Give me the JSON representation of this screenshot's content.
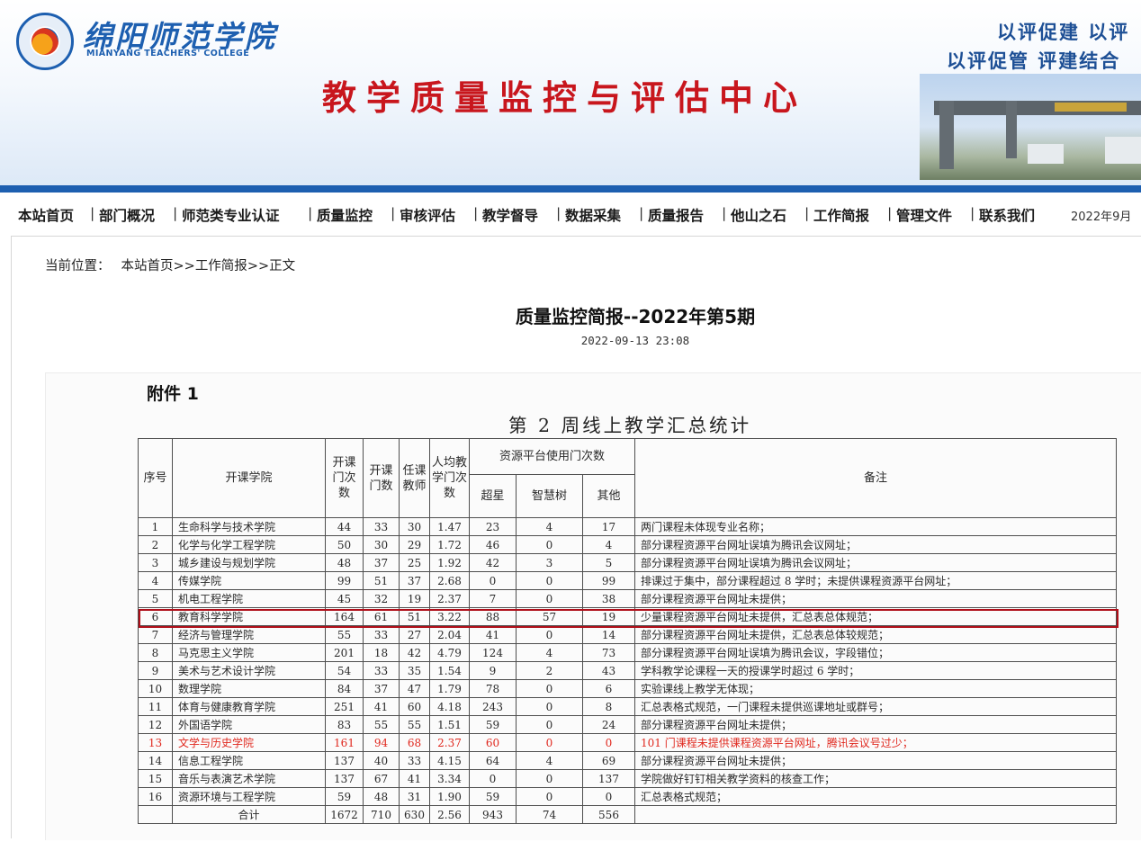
{
  "header": {
    "logo_text": "绵阳师范学院",
    "logo_en": "MIANYANG TEACHERS' COLLEGE",
    "center_title": "教学质量监控与评估中心",
    "slogan_line1": "以评促建 以评",
    "slogan_line2": "以评促管 评建结合"
  },
  "nav": {
    "items": [
      "本站首页",
      "部门概况",
      "师范类专业认证",
      "质量监控",
      "审核评估",
      "教学督导",
      "数据采集",
      "质量报告",
      "他山之石",
      "工作简报",
      "管理文件",
      "联系我们"
    ],
    "separator": "|",
    "date_text": "2022年9月"
  },
  "breadcrumb": {
    "label": "当前位置：",
    "home": "本站首页",
    "sep": ">>",
    "section": "工作简报",
    "current": "正文"
  },
  "article": {
    "title": "质量监控简报--2022年第5期",
    "time": "2022-09-13 23:08"
  },
  "attachment": {
    "label": "附件 1",
    "table_title": "第 2 周线上教学汇总统计",
    "headers": {
      "seq": "序号",
      "college": "开课学院",
      "course_sessions": "开课门次数",
      "courses": "开课门数",
      "teachers": "任课教师",
      "avg_per_teacher": "人均教学门次数",
      "platform_group": "资源平台使用门次数",
      "chaoxing": "超星",
      "zhihuishu": "智慧树",
      "other": "其他",
      "remark": "备注"
    },
    "rows": [
      {
        "seq": "1",
        "college": "生命科学与技术学院",
        "sessions": "44",
        "courses": "33",
        "teachers": "30",
        "avg": "1.47",
        "chaoxing": "23",
        "zhihuishu": "4",
        "other": "17",
        "remark": "两门课程未体现专业名称；"
      },
      {
        "seq": "2",
        "college": "化学与化学工程学院",
        "sessions": "50",
        "courses": "30",
        "teachers": "29",
        "avg": "1.72",
        "chaoxing": "46",
        "zhihuishu": "0",
        "other": "4",
        "remark": "部分课程资源平台网址误填为腾讯会议网址；"
      },
      {
        "seq": "3",
        "college": "城乡建设与规划学院",
        "sessions": "48",
        "courses": "37",
        "teachers": "25",
        "avg": "1.92",
        "chaoxing": "42",
        "zhihuishu": "3",
        "other": "5",
        "remark": "部分课程资源平台网址误填为腾讯会议网址；"
      },
      {
        "seq": "4",
        "college": "传媒学院",
        "sessions": "99",
        "courses": "51",
        "teachers": "37",
        "avg": "2.68",
        "chaoxing": "0",
        "zhihuishu": "0",
        "other": "99",
        "remark": "排课过于集中，部分课程超过 8 学时；未提供课程资源平台网址；"
      },
      {
        "seq": "5",
        "college": "机电工程学院",
        "sessions": "45",
        "courses": "32",
        "teachers": "19",
        "avg": "2.37",
        "chaoxing": "7",
        "zhihuishu": "0",
        "other": "38",
        "remark": "部分课程资源平台网址未提供；"
      },
      {
        "seq": "6",
        "college": "教育科学学院",
        "sessions": "164",
        "courses": "61",
        "teachers": "51",
        "avg": "3.22",
        "chaoxing": "88",
        "zhihuishu": "57",
        "other": "19",
        "remark": "少量课程资源平台网址未提供，汇总表总体规范；"
      },
      {
        "seq": "7",
        "college": "经济与管理学院",
        "sessions": "55",
        "courses": "33",
        "teachers": "27",
        "avg": "2.04",
        "chaoxing": "41",
        "zhihuishu": "0",
        "other": "14",
        "remark": "部分课程资源平台网址未提供，汇总表总体较规范；"
      },
      {
        "seq": "8",
        "college": "马克思主义学院",
        "sessions": "201",
        "courses": "18",
        "teachers": "42",
        "avg": "4.79",
        "chaoxing": "124",
        "zhihuishu": "4",
        "other": "73",
        "remark": "部分课程资源平台网址误填为腾讯会议，字段错位；"
      },
      {
        "seq": "9",
        "college": "美术与艺术设计学院",
        "sessions": "54",
        "courses": "33",
        "teachers": "35",
        "avg": "1.54",
        "chaoxing": "9",
        "zhihuishu": "2",
        "other": "43",
        "remark": "学科教学论课程一天的授课学时超过 6 学时；"
      },
      {
        "seq": "10",
        "college": "数理学院",
        "sessions": "84",
        "courses": "37",
        "teachers": "47",
        "avg": "1.79",
        "chaoxing": "78",
        "zhihuishu": "0",
        "other": "6",
        "remark": "实验课线上教学无体现；"
      },
      {
        "seq": "11",
        "college": "体育与健康教育学院",
        "sessions": "251",
        "courses": "41",
        "teachers": "60",
        "avg": "4.18",
        "chaoxing": "243",
        "zhihuishu": "0",
        "other": "8",
        "remark": "汇总表格式规范，一门课程未提供巡课地址或群号；"
      },
      {
        "seq": "12",
        "college": "外国语学院",
        "sessions": "83",
        "courses": "55",
        "teachers": "55",
        "avg": "1.51",
        "chaoxing": "59",
        "zhihuishu": "0",
        "other": "24",
        "remark": "部分课程资源平台网址未提供；"
      },
      {
        "seq": "13",
        "college": "文学与历史学院",
        "sessions": "161",
        "courses": "94",
        "teachers": "68",
        "avg": "2.37",
        "chaoxing": "60",
        "zhihuishu": "0",
        "other": "0",
        "remark": "101 门课程未提供课程资源平台网址，腾讯会议号过少；"
      },
      {
        "seq": "14",
        "college": "信息工程学院",
        "sessions": "137",
        "courses": "40",
        "teachers": "33",
        "avg": "4.15",
        "chaoxing": "64",
        "zhihuishu": "4",
        "other": "69",
        "remark": "部分课程资源平台网址未提供；"
      },
      {
        "seq": "15",
        "college": "音乐与表演艺术学院",
        "sessions": "137",
        "courses": "67",
        "teachers": "41",
        "avg": "3.34",
        "chaoxing": "0",
        "zhihuishu": "0",
        "other": "137",
        "remark": "学院做好钉钉相关教学资料的核查工作；"
      },
      {
        "seq": "16",
        "college": "资源环境与工程学院",
        "sessions": "59",
        "courses": "48",
        "teachers": "31",
        "avg": "1.90",
        "chaoxing": "59",
        "zhihuishu": "0",
        "other": "0",
        "remark": "汇总表格式规范；"
      }
    ],
    "total": {
      "label": "合计",
      "sessions": "1672",
      "courses": "710",
      "teachers": "630",
      "avg": "2.56",
      "chaoxing": "943",
      "zhihuishu": "74",
      "other": "556",
      "remark": ""
    },
    "highlighted_row_seq": "6",
    "red_row_seq": "13"
  },
  "colors": {
    "title_red": "#c8161d",
    "brand_blue": "#1d5fb0",
    "highlight_box": "#b00f1a",
    "red_row_text": "#e0281e"
  }
}
